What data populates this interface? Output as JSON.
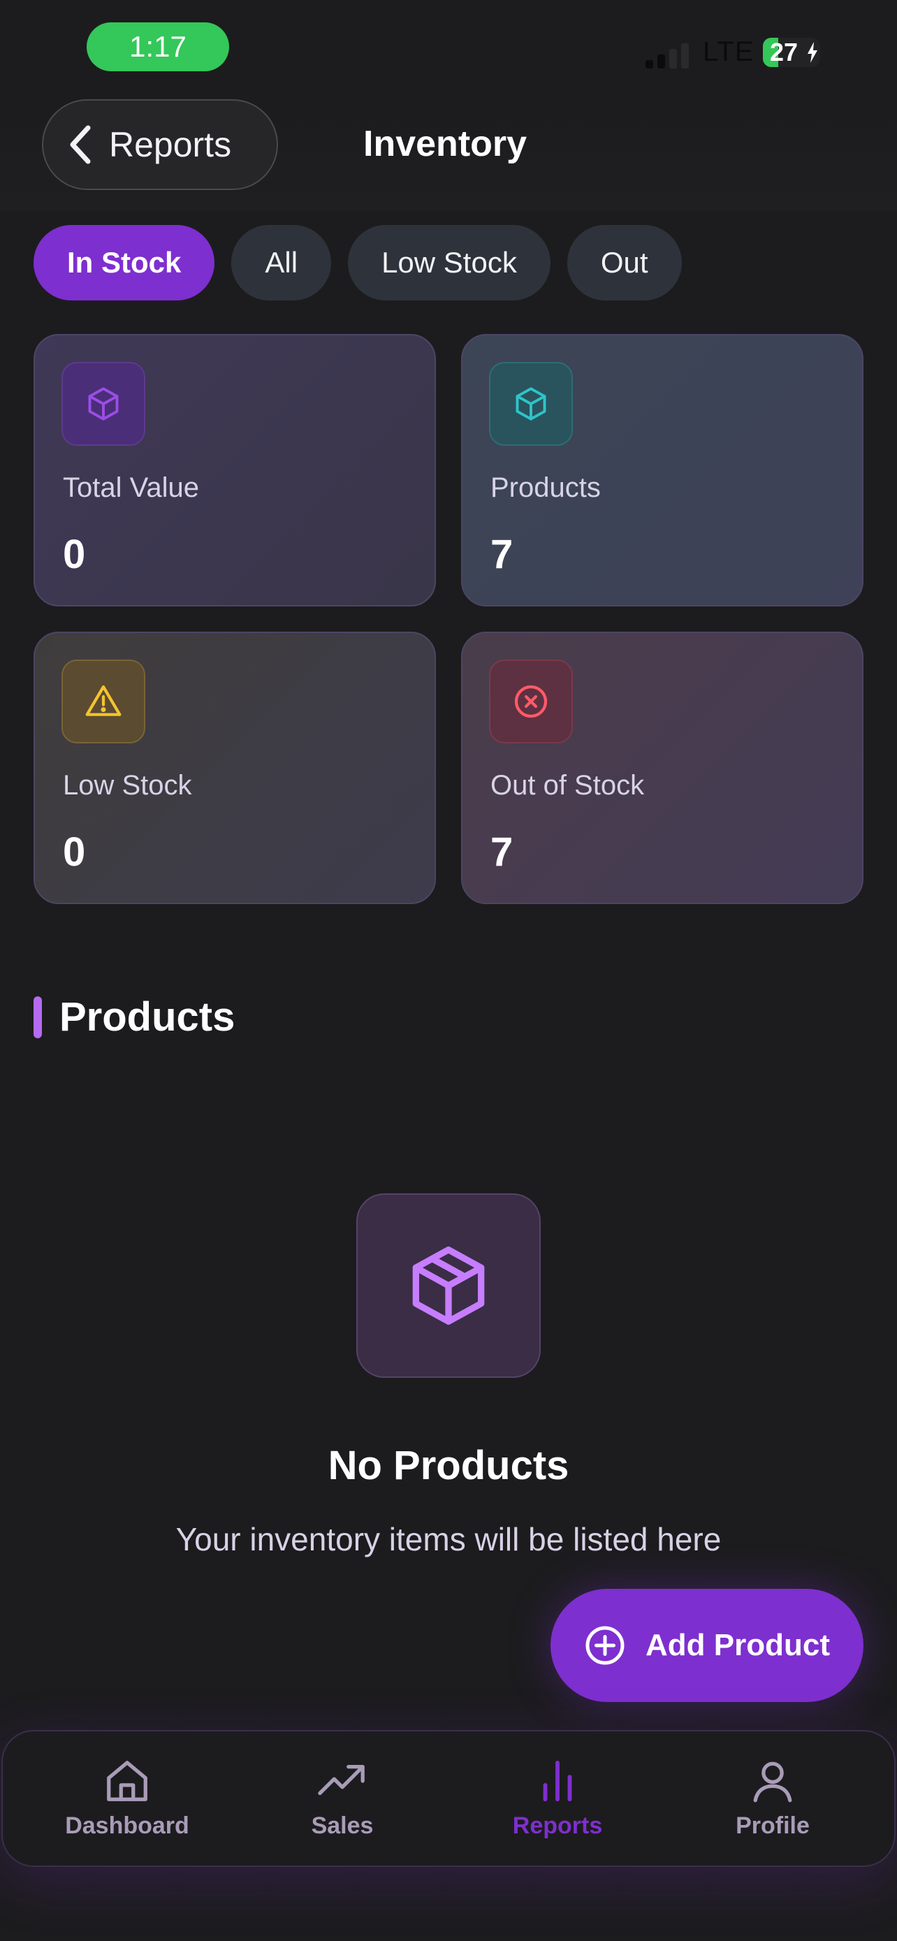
{
  "status_bar": {
    "time": "1:17",
    "network": "LTE",
    "battery": "27",
    "battery_fraction": 0.27,
    "time_pill_color": "#34c759"
  },
  "header": {
    "back_label": "Reports",
    "title": "Inventory"
  },
  "filters": {
    "chips": [
      {
        "label": "In Stock",
        "active": true
      },
      {
        "label": "All",
        "active": false
      },
      {
        "label": "Low Stock",
        "active": false
      },
      {
        "label": "Out",
        "active": false
      }
    ],
    "active_color": "#7e2fcf"
  },
  "stats": {
    "total_value": {
      "label": "Total Value",
      "value": "0",
      "icon": "cube-icon",
      "color": "#9b4de6"
    },
    "products": {
      "label": "Products",
      "value": "7",
      "icon": "cube-icon",
      "color": "#2ec4c9"
    },
    "low_stock": {
      "label": "Low Stock",
      "value": "0",
      "icon": "warning-icon",
      "color": "#f4c430"
    },
    "out_of_stock": {
      "label": "Out of Stock",
      "value": "7",
      "icon": "x-circle-icon",
      "color": "#ff5a6a"
    }
  },
  "section": {
    "title": "Products",
    "accent_color": "#b46bf2"
  },
  "empty_state": {
    "icon": "package-icon",
    "title": "No Products",
    "subtitle": "Your inventory items will be listed here"
  },
  "fab": {
    "label": "Add Product",
    "icon": "plus-circle-icon"
  },
  "tabbar": {
    "items": [
      {
        "label": "Dashboard",
        "icon": "home-icon",
        "active": false
      },
      {
        "label": "Sales",
        "icon": "trending-up-icon",
        "active": false
      },
      {
        "label": "Reports",
        "icon": "bar-chart-icon",
        "active": true
      },
      {
        "label": "Profile",
        "icon": "user-icon",
        "active": false
      }
    ]
  }
}
